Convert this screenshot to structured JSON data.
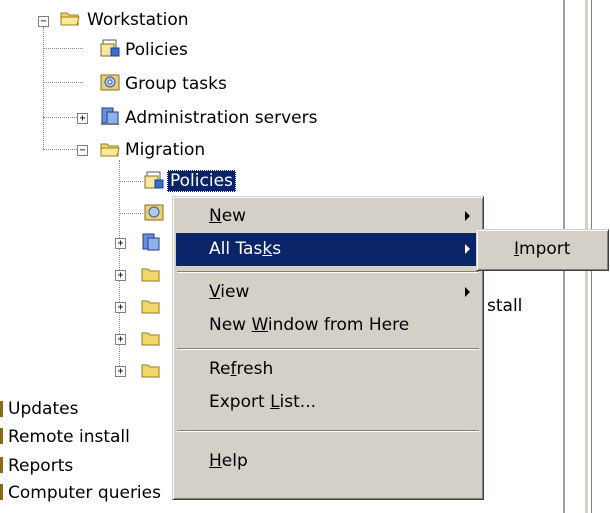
{
  "tree": {
    "workstation": "Workstation",
    "policies": "Policies",
    "group_tasks": "Group tasks",
    "admin_servers": "Administration servers",
    "migration": "Migration",
    "migration_policies": "Policies",
    "partial_stall": "stall",
    "updates": "Updates",
    "remote_install": "Remote install",
    "reports": "Reports",
    "computer_queries": "Computer queries"
  },
  "context_menu": {
    "new": {
      "pre": "",
      "u": "N",
      "post": "ew"
    },
    "all_tasks": {
      "pre": "All Tas",
      "u": "k",
      "post": "s"
    },
    "view": {
      "pre": "",
      "u": "V",
      "post": "iew"
    },
    "new_window": {
      "pre": "New ",
      "u": "W",
      "post": "indow from Here"
    },
    "refresh": {
      "pre": "Re",
      "u": "f",
      "post": "resh"
    },
    "export_list": {
      "pre": "Export ",
      "u": "L",
      "post": "ist..."
    },
    "help": {
      "pre": "",
      "u": "H",
      "post": "elp"
    }
  },
  "submenu": {
    "import": {
      "pre": "",
      "u": "I",
      "post": "mport"
    }
  },
  "colors": {
    "highlight": "#0a246a",
    "menu_face": "#d4d0c8",
    "folder": "#f3d56a"
  }
}
